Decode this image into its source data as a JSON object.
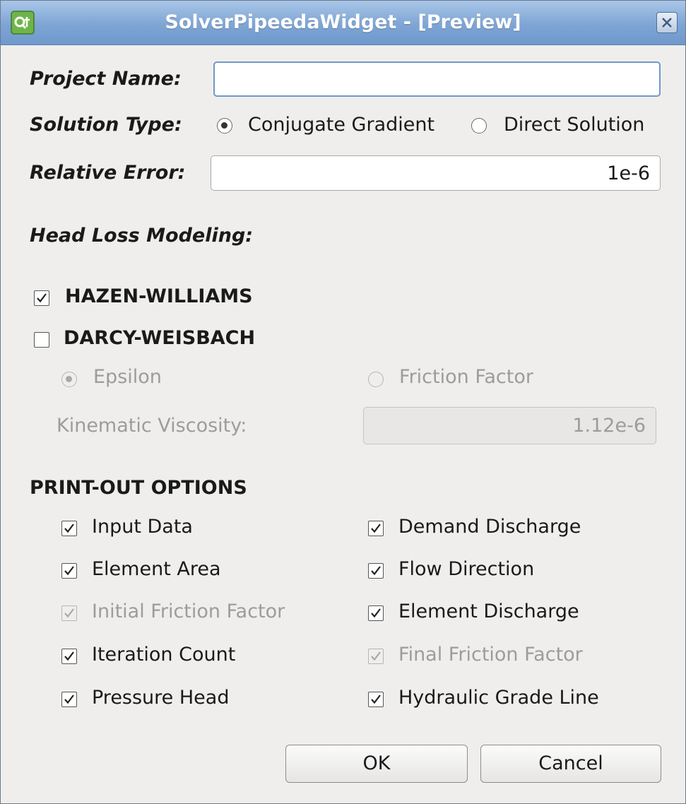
{
  "window": {
    "title": "SolverPipeedaWidget - [Preview]"
  },
  "project_name": {
    "label": "Project Name:",
    "value": ""
  },
  "solution_type": {
    "label": "Solution Type:",
    "options": [
      "Conjugate Gradient",
      "Direct Solution"
    ],
    "selected": "Conjugate Gradient"
  },
  "relative_error": {
    "label": "Relative Error:",
    "value": "1e-6"
  },
  "head_loss": {
    "label": "Head Loss Modeling:",
    "hazen_williams": {
      "label": "HAZEN-WILLIAMS",
      "checked": true
    },
    "darcy_weisbach": {
      "label": "DARCY-WEISBACH",
      "checked": false
    },
    "epsilon": {
      "label": "Epsilon",
      "selected": true,
      "enabled": false
    },
    "friction_factor": {
      "label": "Friction Factor",
      "selected": false,
      "enabled": false
    },
    "kinematic_viscosity": {
      "label": "Kinematic Viscosity:",
      "value": "1.12e-6",
      "enabled": false
    }
  },
  "print_out": {
    "label": "PRINT-OUT OPTIONS",
    "left": [
      {
        "label": "Input Data",
        "checked": true,
        "enabled": true
      },
      {
        "label": "Element Area",
        "checked": true,
        "enabled": true
      },
      {
        "label": "Initial Friction Factor",
        "checked": true,
        "enabled": false
      },
      {
        "label": "Iteration Count",
        "checked": true,
        "enabled": true
      },
      {
        "label": "Pressure Head",
        "checked": true,
        "enabled": true
      }
    ],
    "right": [
      {
        "label": "Demand Discharge",
        "checked": true,
        "enabled": true
      },
      {
        "label": "Flow Direction",
        "checked": true,
        "enabled": true
      },
      {
        "label": "Element Discharge",
        "checked": true,
        "enabled": true
      },
      {
        "label": "Final Friction Factor",
        "checked": true,
        "enabled": false
      },
      {
        "label": "Hydraulic Grade Line",
        "checked": true,
        "enabled": true
      }
    ]
  },
  "buttons": {
    "ok": "OK",
    "cancel": "Cancel"
  }
}
